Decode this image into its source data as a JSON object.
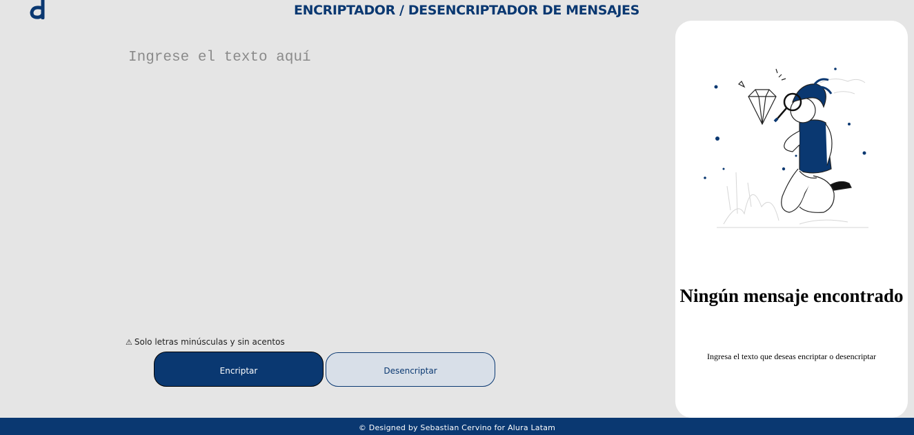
{
  "header": {
    "logo_icon": "alura-logo-icon",
    "title": "ENCRIPTADOR / DESENCRIPTADOR DE MENSAJES"
  },
  "input": {
    "placeholder": "Ingrese el texto aquí",
    "value": ""
  },
  "warning": {
    "icon": "⚠",
    "text": "Solo letras minúsculas y sin acentos"
  },
  "buttons": {
    "encrypt_label": "Encriptar",
    "decrypt_label": "Desencriptar"
  },
  "output": {
    "illustration_icon": "person-magnifying-glass-illustration",
    "title": "Ningún mensaje encontrado",
    "subtitle": "Ingresa el texto que deseas encriptar o desencriptar"
  },
  "footer": {
    "text": "© Designed by Sebastian Cervino for Alura Latam"
  },
  "colors": {
    "primary": "#0a3871",
    "background": "#e5e5e5",
    "panel": "#ffffff",
    "secondary_button": "#d8dfe8"
  }
}
